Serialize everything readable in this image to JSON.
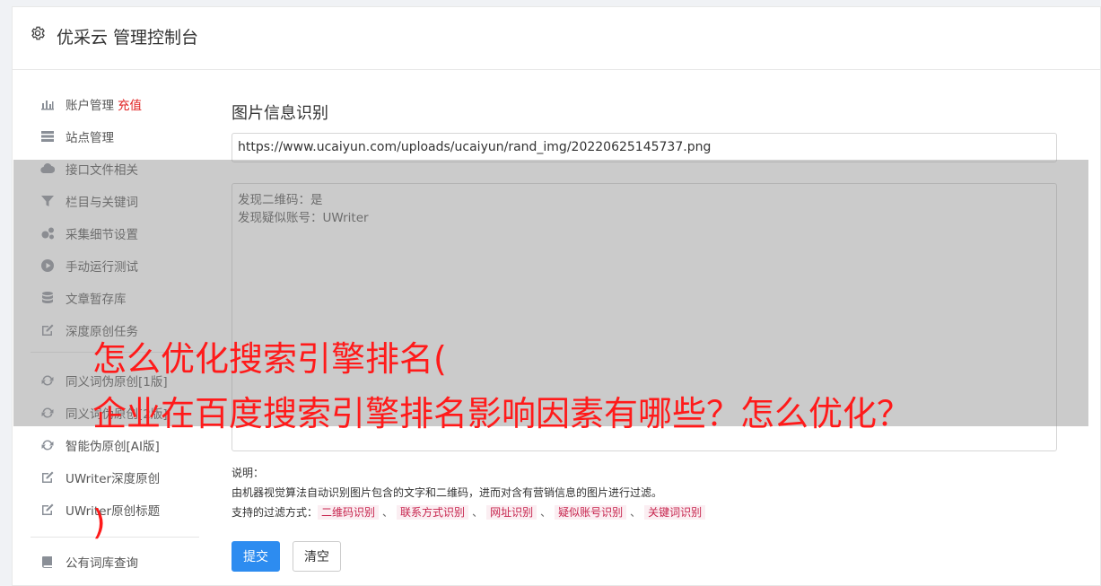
{
  "header": {
    "title": "优采云 管理控制台",
    "icon": "gear-icon"
  },
  "sidebar": {
    "items": [
      {
        "label": "账户管理",
        "badge": "充值",
        "icon": "bar-chart-icon"
      },
      {
        "label": "站点管理",
        "icon": "server-icon"
      },
      {
        "label": "接口文件相关",
        "icon": "cloud-upload-icon"
      },
      {
        "label": "栏目与关键词",
        "icon": "filter-icon"
      },
      {
        "label": "采集细节设置",
        "icon": "cogs-icon"
      },
      {
        "label": "手动运行测试",
        "icon": "play-circle-icon"
      },
      {
        "label": "文章暂存库",
        "icon": "database-icon"
      },
      {
        "label": "深度原创任务",
        "icon": "edit-icon"
      },
      {
        "label": "同义词伪原创[1版]",
        "icon": "refresh-icon"
      },
      {
        "label": "同义词伪原创[2版]",
        "icon": "refresh-icon"
      },
      {
        "label": "智能伪原创[AI版]",
        "icon": "refresh-icon"
      },
      {
        "label": "UWriter深度原创",
        "icon": "edit-icon"
      },
      {
        "label": "UWriter原创标题",
        "icon": "edit-icon"
      },
      {
        "label": "公有词库查询",
        "icon": "book-icon"
      }
    ]
  },
  "main": {
    "title": "图片信息识别",
    "url_value": "https://www.ucaiyun.com/uploads/ucaiyun/rand_img/20220625145737.png",
    "result_lines": [
      "发现二维码：是",
      "发现疑似账号：UWriter"
    ],
    "notes_label": "说明：",
    "notes_text": "由机器视觉算法自动识别图片包含的文字和二维码，进而对含有营销信息的图片进行过滤。",
    "filter_label": "支持的过滤方式：",
    "filter_tags": [
      "二维码识别",
      "联系方式识别",
      "网址识别",
      "疑似账号识别",
      "关键词识别"
    ],
    "tag_separator": "、",
    "submit_label": "提交",
    "clear_label": "清空"
  },
  "overlay": {
    "line1": "怎么优化搜索引擎排名(",
    "line2": "企业在百度搜索引擎排名影响因素有哪些？怎么优化？",
    "line3": ")"
  }
}
